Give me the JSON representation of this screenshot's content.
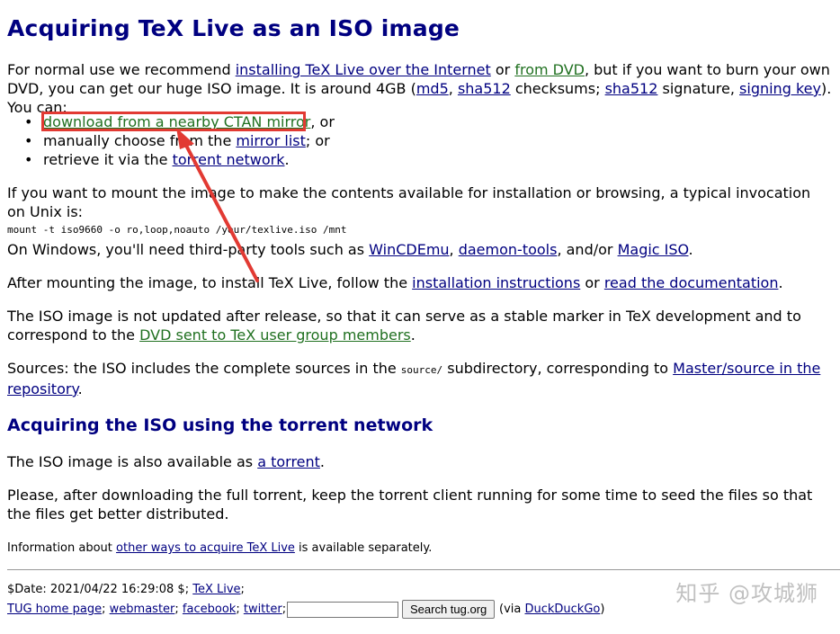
{
  "title": "Acquiring TeX Live as an ISO image",
  "intro": {
    "t1": "For normal use we recommend ",
    "link_internet": "installing TeX Live over the Internet",
    "t2": " or ",
    "link_dvd": "from DVD",
    "t3": ", but if you want to burn your own DVD, you can get our huge ISO image. It is around 4GB (",
    "link_md5": "md5",
    "t4": ", ",
    "link_sha512": "sha512",
    "t5": " checksums; ",
    "link_sha512_sig": "sha512",
    "t6": " signature, ",
    "link_signing_key": "signing key",
    "t7": "). You can:"
  },
  "options": [
    {
      "bullet": "•",
      "link": "download from a nearby CTAN mirror",
      "after": ", or",
      "before": ""
    },
    {
      "bullet": "•",
      "before": "manually choose from the ",
      "link": "mirror list",
      "after": "; or"
    },
    {
      "bullet": "•",
      "before": "retrieve it via the ",
      "link": "torrent network",
      "after": "."
    }
  ],
  "mount": {
    "text": "If you want to mount the image to make the contents available for installation or browsing, a typical invocation on Unix is:",
    "command": "mount -t iso9660 -o ro,loop,noauto /your/texlive.iso /mnt",
    "win_t1": "On Windows, you'll need third-party tools such as ",
    "link_wincdemu": "WinCDEmu",
    "win_t2": ", ",
    "link_daemon": "daemon-tools",
    "win_t3": ", and/or ",
    "link_magic": "Magic ISO",
    "win_t4": "."
  },
  "after_mount": {
    "t1": "After mounting the image, to install TeX Live, follow the ",
    "link_install": "installation instructions",
    "t2": " or ",
    "link_docs": "read the documentation",
    "t3": "."
  },
  "not_updated": {
    "t1": "The ISO image is not updated after release, so that it can serve as a stable marker in TeX development and to correspond to the ",
    "link_dvd_sent": "DVD sent to TeX user group members",
    "t2": "."
  },
  "sources": {
    "t1": "Sources: the ISO includes the complete sources in the ",
    "code": "source/",
    "t2": " subdirectory, corresponding to ",
    "link_repo": "Master/source in the repository",
    "t3": "."
  },
  "torrent_heading": "Acquiring the ISO using the torrent network",
  "torrent_avail": {
    "t1": "The ISO image is also available as ",
    "link": "a torrent",
    "t2": "."
  },
  "torrent_please": "Please, after downloading the full torrent, keep the torrent client running for some time to seed the files so that the files get better distributed.",
  "other_ways": {
    "t1": "Information about ",
    "link": "other ways to acquire TeX Live",
    "t2": " is available separately."
  },
  "footer": {
    "date": "$Date: 2021/04/22 16:29:08 $; ",
    "link_texlive": "TeX Live",
    "sep": ";",
    "link_tug": "TUG home page",
    "link_webmaster": "webmaster",
    "link_facebook": "facebook",
    "link_twitter": "twitter",
    "search_button": "Search tug.org",
    "via_t1": "(via ",
    "link_ddg": "DuckDuckGo",
    "via_t2": ")"
  },
  "watermark": "知乎 @攻城狮",
  "colors": {
    "heading": "#000080",
    "link": "#000080",
    "link_green": "#207020",
    "annotation": "#e23a33"
  }
}
